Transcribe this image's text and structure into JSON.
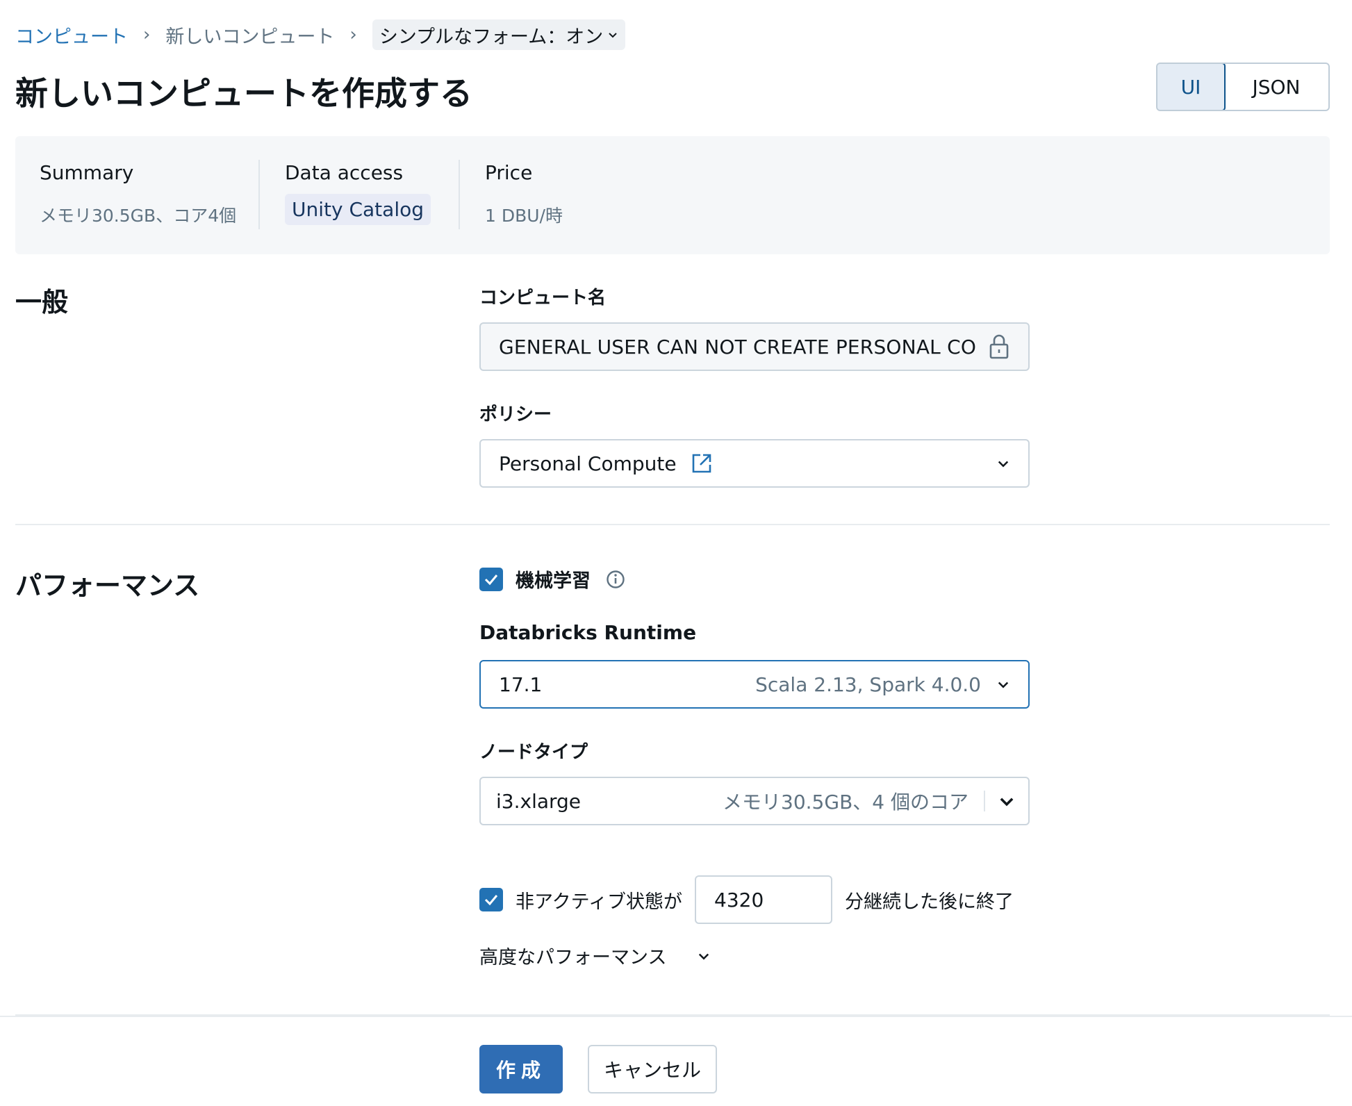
{
  "breadcrumb": {
    "items": [
      "コンピュート",
      "新しいコンピュート"
    ],
    "simple_form_label": "シンプルなフォーム：オン"
  },
  "page": {
    "title": "新しいコンピュートを作成する"
  },
  "view_toggle": {
    "options": [
      "UI",
      "JSON"
    ],
    "selected": "UI"
  },
  "summary": {
    "summary_label": "Summary",
    "summary_value": "メモリ30.5GB、コア4個",
    "data_access_label": "Data access",
    "data_access_value": "Unity Catalog",
    "price_label": "Price",
    "price_value": "1 DBU/時"
  },
  "general": {
    "section_title": "一般",
    "compute_name_label": "コンピュート名",
    "compute_name_value": "GENERAL USER CAN NOT CREATE PERSONAL COMPUTE",
    "policy_label": "ポリシー",
    "policy_value": "Personal Compute"
  },
  "performance": {
    "section_title": "パフォーマンス",
    "ml_label": "機械学習",
    "ml_checked": true,
    "runtime_label": "Databricks Runtime",
    "runtime_version": "17.1",
    "runtime_detail": "Scala 2.13, Spark 4.0.0",
    "node_type_label": "ノードタイプ",
    "node_type_value": "i3.xlarge",
    "node_type_detail": "メモリ30.5GB、4 個のコア",
    "terminate_checked": true,
    "terminate_prefix": "非アクティブ状態が",
    "terminate_minutes": "4320",
    "terminate_suffix": "分継続した後に終了",
    "advanced_label": "高度なパフォーマンス"
  },
  "footer": {
    "create_label": "作成",
    "cancel_label": "キャンセル"
  },
  "colors": {
    "accent": "#2272b4",
    "primary_button": "#2f6db4"
  }
}
